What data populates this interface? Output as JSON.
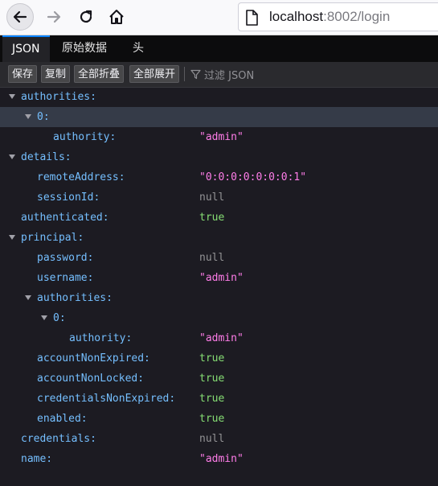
{
  "browser": {
    "url_host": "localhost",
    "url_path": ":8002/login"
  },
  "tabs": [
    "JSON",
    "原始数据",
    "头"
  ],
  "toolbar": {
    "save": "保存",
    "copy": "复制",
    "collapse_all": "全部折叠",
    "expand_all": "全部展开",
    "filter_placeholder": "过滤 JSON"
  },
  "tree": [
    {
      "key": "authorities:",
      "value": "",
      "type": "obj",
      "depth": 0,
      "expandable": true
    },
    {
      "key": "0:",
      "value": "",
      "type": "obj",
      "depth": 1,
      "expandable": true,
      "selected": true
    },
    {
      "key": "authority:",
      "value": "\"admin\"",
      "type": "string",
      "depth": 2
    },
    {
      "key": "details:",
      "value": "",
      "type": "obj",
      "depth": 0,
      "expandable": true
    },
    {
      "key": "remoteAddress:",
      "value": "\"0:0:0:0:0:0:0:1\"",
      "type": "string",
      "depth": 1
    },
    {
      "key": "sessionId:",
      "value": "null",
      "type": "null",
      "depth": 1
    },
    {
      "key": "authenticated:",
      "value": "true",
      "type": "bool",
      "depth": 0
    },
    {
      "key": "principal:",
      "value": "",
      "type": "obj",
      "depth": 0,
      "expandable": true
    },
    {
      "key": "password:",
      "value": "null",
      "type": "null",
      "depth": 1
    },
    {
      "key": "username:",
      "value": "\"admin\"",
      "type": "string",
      "depth": 1
    },
    {
      "key": "authorities:",
      "value": "",
      "type": "obj",
      "depth": 1,
      "expandable": true
    },
    {
      "key": "0:",
      "value": "",
      "type": "obj",
      "depth": 2,
      "expandable": true
    },
    {
      "key": "authority:",
      "value": "\"admin\"",
      "type": "string",
      "depth": 3
    },
    {
      "key": "accountNonExpired:",
      "value": "true",
      "type": "bool",
      "depth": 1
    },
    {
      "key": "accountNonLocked:",
      "value": "true",
      "type": "bool",
      "depth": 1
    },
    {
      "key": "credentialsNonExpired:",
      "value": "true",
      "type": "bool",
      "depth": 1
    },
    {
      "key": "enabled:",
      "value": "true",
      "type": "bool",
      "depth": 1
    },
    {
      "key": "credentials:",
      "value": "null",
      "type": "null",
      "depth": 0
    },
    {
      "key": "name:",
      "value": "\"admin\"",
      "type": "string",
      "depth": 0
    }
  ]
}
